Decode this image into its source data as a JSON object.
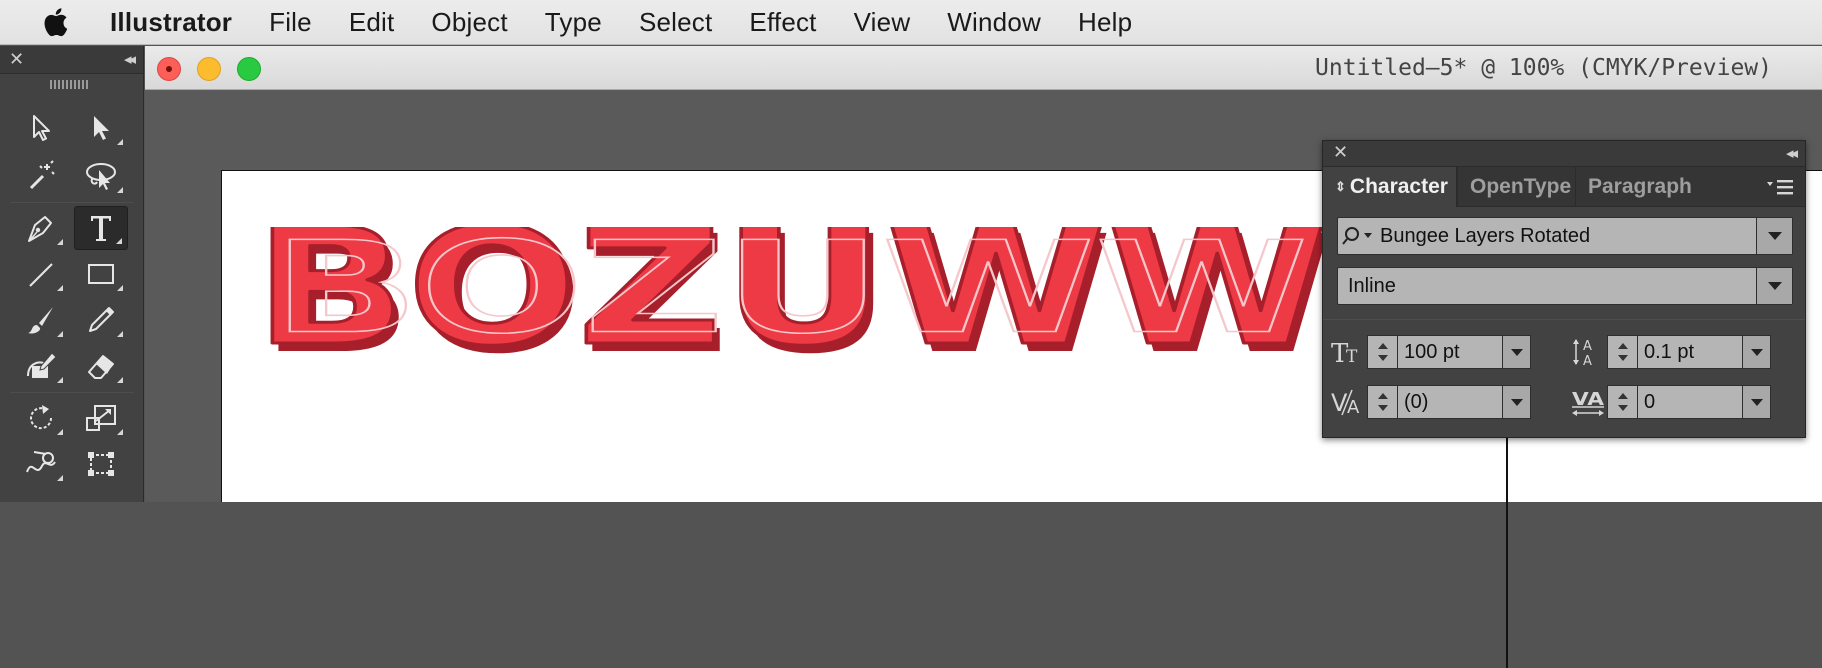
{
  "menubar": {
    "app_name": "Illustrator",
    "items": [
      "File",
      "Edit",
      "Object",
      "Type",
      "Select",
      "Effect",
      "View",
      "Window",
      "Help"
    ]
  },
  "tools": {
    "close_glyph": "✕",
    "collapse_glyph": "◂◂",
    "items": [
      "selection-tool",
      "direct-selection-tool",
      "magic-wand-tool",
      "lasso-tool",
      "pen-tool",
      "type-tool",
      "line-segment-tool",
      "rectangle-tool",
      "paintbrush-tool",
      "pencil-tool",
      "shaper-tool",
      "eraser-tool",
      "rotate-tool",
      "scale-tool",
      "warp-tool",
      "free-transform-tool"
    ],
    "active": "type-tool"
  },
  "document": {
    "title": "Untitled–5* @ 100% (CMYK/Preview)"
  },
  "artwork": {
    "text": "BOZUWW",
    "fill_color": "#ee3a45",
    "extrude_color": "#a71f2b",
    "inline_color": "#f5c7cb"
  },
  "character_panel": {
    "close_glyph": "✕",
    "collapse_glyph": "◂◂",
    "tabs": [
      "Character",
      "OpenType",
      "Paragraph"
    ],
    "active_tab": "Character",
    "font_family": "Bungee Layers Rotated",
    "font_style": "Inline",
    "font_size": "100 pt",
    "leading": "0.1 pt",
    "kerning": "(0)",
    "tracking": "0"
  }
}
